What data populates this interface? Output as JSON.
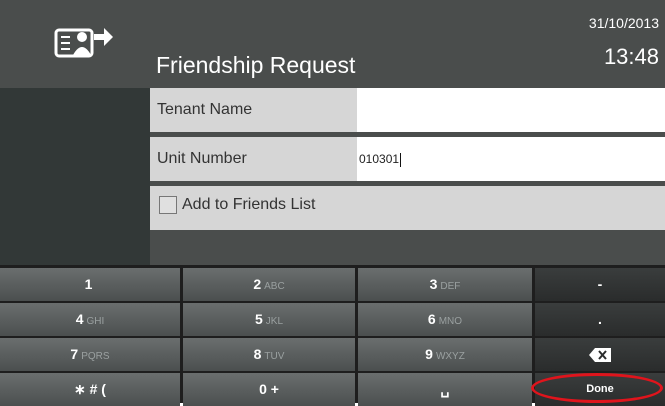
{
  "header": {
    "title": "Friendship Request",
    "date": "31/10/2013",
    "time": "13:48",
    "icon": "contact-transfer-icon"
  },
  "form": {
    "tenant_label": "Tenant Name",
    "tenant_value": "",
    "unit_label": "Unit Number",
    "unit_value": "010301",
    "add_friends_label": "Add to Friends List",
    "add_friends_checked": false
  },
  "keypad": {
    "rows": [
      [
        {
          "main": "1",
          "sub": ""
        },
        {
          "main": "2",
          "sub": "ABC"
        },
        {
          "main": "3",
          "sub": "DEF"
        },
        {
          "main": "-",
          "sub": ""
        }
      ],
      [
        {
          "main": "4",
          "sub": "GHI"
        },
        {
          "main": "5",
          "sub": "JKL"
        },
        {
          "main": "6",
          "sub": "MNO"
        },
        {
          "main": ".",
          "sub": ""
        }
      ],
      [
        {
          "main": "7",
          "sub": "PQRS"
        },
        {
          "main": "8",
          "sub": "TUV"
        },
        {
          "main": "9",
          "sub": "WXYZ"
        },
        {
          "main": "",
          "sub": "",
          "icon": "backspace-icon"
        }
      ],
      [
        {
          "main": "∗ # (",
          "sub": ""
        },
        {
          "main": "0 +",
          "sub": ""
        },
        {
          "main": "␣",
          "sub": ""
        },
        {
          "main": "Done",
          "sub": ""
        }
      ]
    ]
  },
  "colors": {
    "header_bg": "#4a4d4c",
    "panel_bg": "#323837",
    "annotation": "#e0141c"
  }
}
